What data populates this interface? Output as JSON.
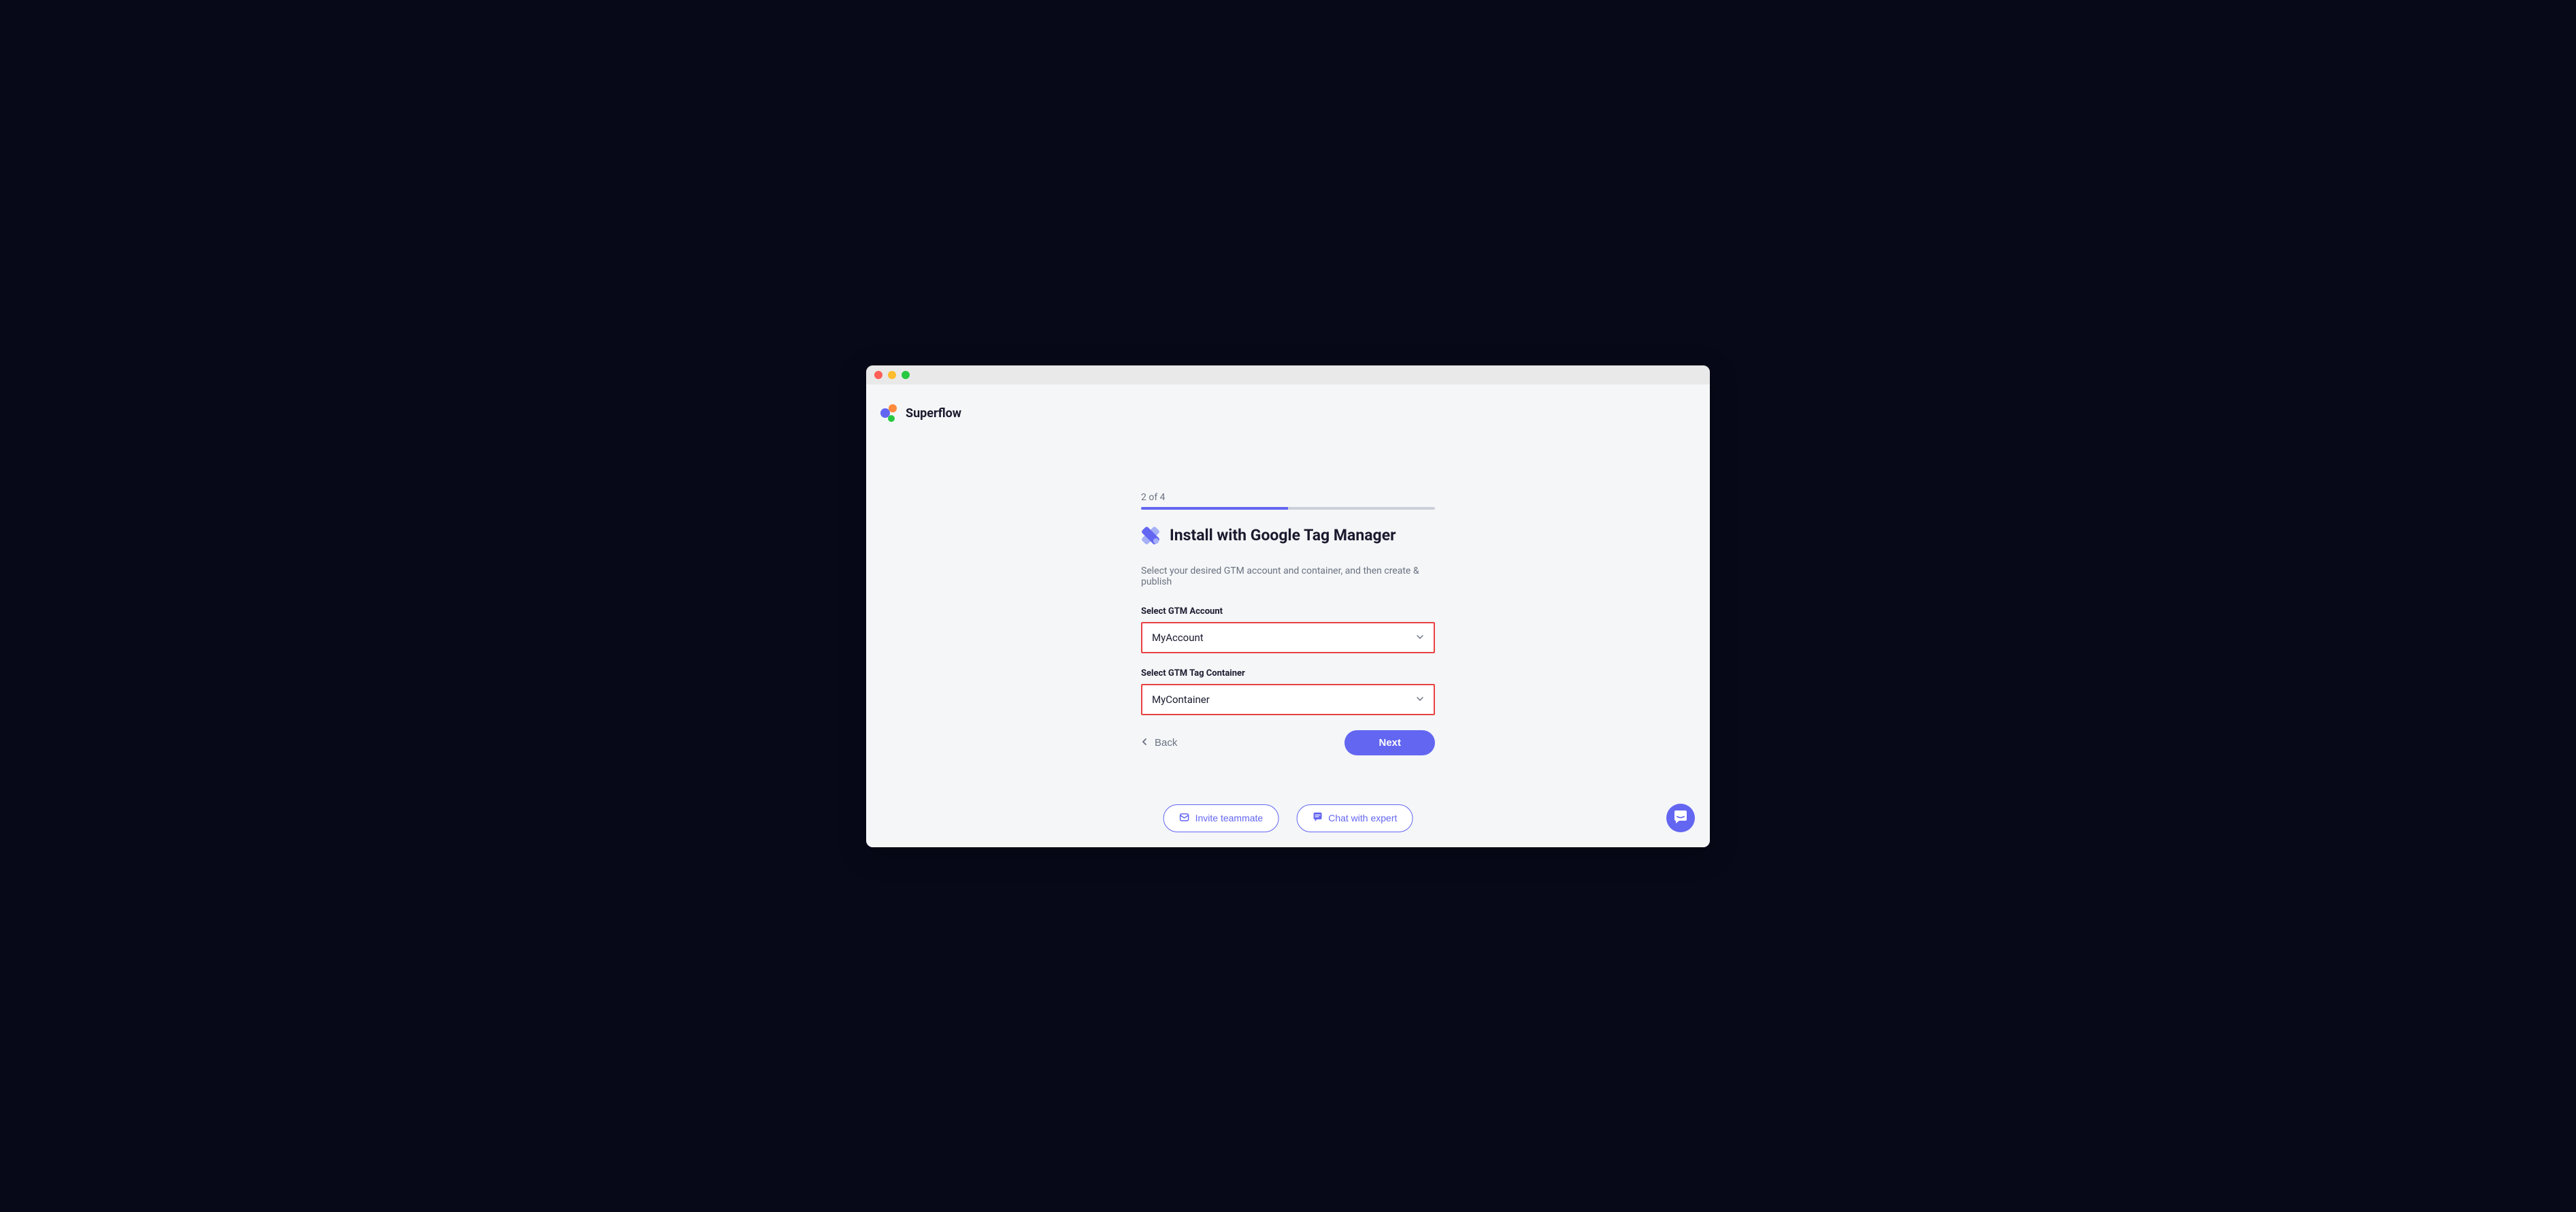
{
  "brand": {
    "name": "Superflow"
  },
  "wizard": {
    "step_label": "2 of 4",
    "progress_percent": 50,
    "title": "Install with Google Tag Manager",
    "description": "Select your desired GTM account and container, and then create & publish"
  },
  "form": {
    "account_label": "Select GTM Account",
    "account_value": "MyAccount",
    "container_label": "Select GTM Tag Container",
    "container_value": "MyContainer"
  },
  "nav": {
    "back_label": "Back",
    "next_label": "Next"
  },
  "footer": {
    "invite_label": "Invite teammate",
    "chat_label": "Chat with expert"
  }
}
